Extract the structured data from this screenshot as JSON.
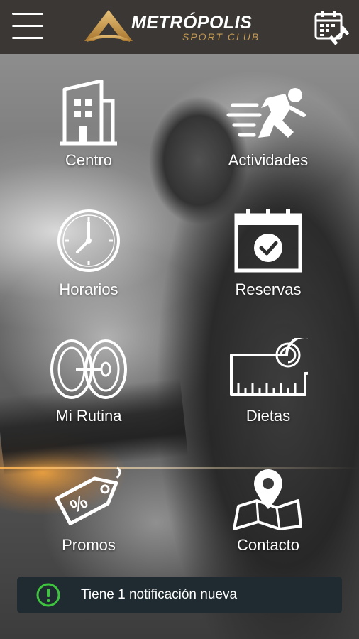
{
  "brand": {
    "title": "METRÓPOLIS",
    "subtitle": "SPORT CLUB",
    "gold": "#c59a53"
  },
  "header": {
    "menu_icon": "hamburger-menu-icon",
    "calendar_icon": "calendar-dumbbell-icon",
    "background": "#3a3734"
  },
  "menu": [
    {
      "label": "Centro",
      "icon": "building-icon"
    },
    {
      "label": "Actividades",
      "icon": "running-person-icon"
    },
    {
      "label": "Horarios",
      "icon": "clock-icon"
    },
    {
      "label": "Reservas",
      "icon": "calendar-check-icon"
    },
    {
      "label": "Mi Rutina",
      "icon": "weight-plates-icon"
    },
    {
      "label": "Dietas",
      "icon": "measuring-tape-icon"
    },
    {
      "label": "Promos",
      "icon": "percent-tag-icon"
    },
    {
      "label": "Contacto",
      "icon": "map-pin-icon"
    }
  ],
  "notification": {
    "text": "Tiene 1 notificación nueva",
    "icon": "exclamation-circle-icon",
    "icon_color": "#3ec43e",
    "background": "#1f2b30"
  }
}
